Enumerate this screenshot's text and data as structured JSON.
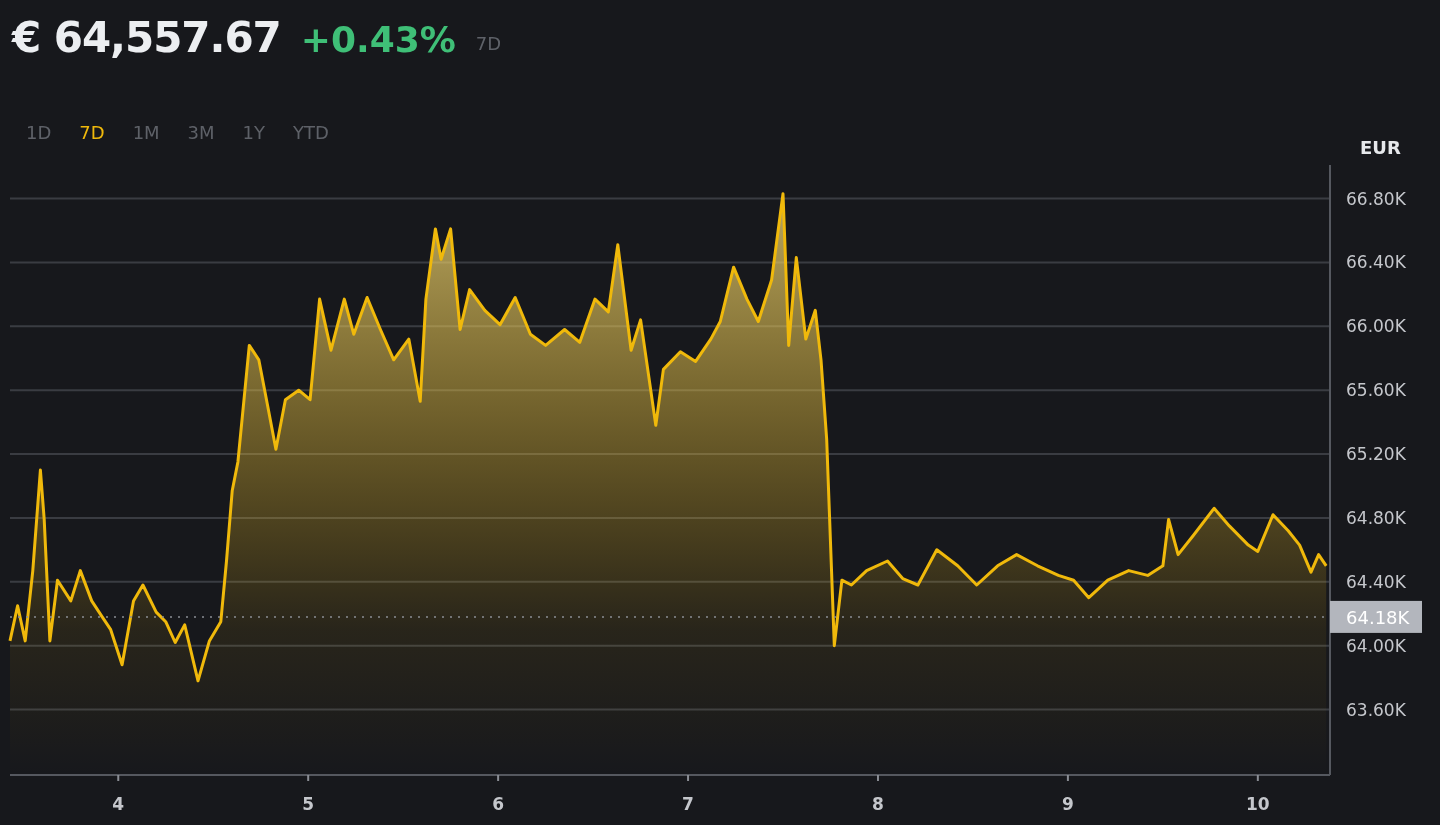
{
  "header": {
    "price": "€ 64,557.67",
    "change": "+0.43%",
    "period": "7D"
  },
  "range_tabs": [
    {
      "label": "1D",
      "selected": false
    },
    {
      "label": "7D",
      "selected": true
    },
    {
      "label": "1M",
      "selected": false
    },
    {
      "label": "3M",
      "selected": false
    },
    {
      "label": "1Y",
      "selected": false
    },
    {
      "label": "YTD",
      "selected": false
    }
  ],
  "chart": {
    "chart_data": {
      "type": "area",
      "grid": true,
      "ylabel": "EUR",
      "xlim": [
        3.43,
        10.38
      ],
      "ylim": [
        63.19,
        67.01
      ],
      "xticks": [
        4,
        5,
        6,
        7,
        8,
        9,
        10
      ],
      "yticks": [
        {
          "value": 66.8,
          "label": "66.80K"
        },
        {
          "value": 66.4,
          "label": "66.40K"
        },
        {
          "value": 66.0,
          "label": "66.00K"
        },
        {
          "value": 65.6,
          "label": "65.60K"
        },
        {
          "value": 65.2,
          "label": "65.20K"
        },
        {
          "value": 64.8,
          "label": "64.80K"
        },
        {
          "value": 64.4,
          "label": "64.40K"
        },
        {
          "value": 64.0,
          "label": "64.00K"
        },
        {
          "value": 63.6,
          "label": "63.60K"
        }
      ],
      "x": [
        3.43,
        3.47,
        3.51,
        3.55,
        3.59,
        3.61,
        3.64,
        3.68,
        3.75,
        3.8,
        3.86,
        3.91,
        3.96,
        4.02,
        4.08,
        4.13,
        4.2,
        4.25,
        4.3,
        4.35,
        4.42,
        4.48,
        4.54,
        4.57,
        4.6,
        4.63,
        4.69,
        4.74,
        4.79,
        4.83,
        4.88,
        4.95,
        5.01,
        5.06,
        5.12,
        5.19,
        5.24,
        5.31,
        5.38,
        5.45,
        5.53,
        5.59,
        5.62,
        5.67,
        5.7,
        5.75,
        5.8,
        5.85,
        5.93,
        6.01,
        6.09,
        6.17,
        6.25,
        6.35,
        6.43,
        6.51,
        6.58,
        6.63,
        6.7,
        6.75,
        6.83,
        6.87,
        6.96,
        7.04,
        7.12,
        7.17,
        7.24,
        7.31,
        7.37,
        7.44,
        7.5,
        7.53,
        7.57,
        7.62,
        7.67,
        7.7,
        7.73,
        7.77,
        7.81,
        7.86,
        7.94,
        8.05,
        8.13,
        8.21,
        8.31,
        8.42,
        8.52,
        8.63,
        8.73,
        8.84,
        8.95,
        9.03,
        9.11,
        9.21,
        9.32,
        9.42,
        9.5,
        9.53,
        9.58,
        9.66,
        9.77,
        9.85,
        9.95,
        10.0,
        10.08,
        10.16,
        10.22,
        10.28,
        10.32,
        10.36
      ],
      "series": [
        {
          "color": "#f0b90b",
          "values": [
            64.03,
            64.25,
            64.03,
            64.47,
            65.1,
            64.79,
            64.03,
            64.41,
            64.28,
            64.47,
            64.28,
            64.19,
            64.1,
            63.88,
            64.28,
            64.38,
            64.21,
            64.15,
            64.02,
            64.13,
            63.78,
            64.03,
            64.15,
            64.53,
            64.97,
            65.15,
            65.88,
            65.79,
            65.48,
            65.23,
            65.54,
            65.6,
            65.54,
            66.17,
            65.85,
            66.17,
            65.95,
            66.18,
            65.98,
            65.79,
            65.92,
            65.53,
            66.17,
            66.61,
            66.42,
            66.61,
            65.98,
            66.23,
            66.1,
            66.01,
            66.18,
            65.95,
            65.88,
            65.98,
            65.9,
            66.17,
            66.09,
            66.51,
            65.85,
            66.04,
            65.38,
            65.73,
            65.84,
            65.78,
            65.92,
            66.03,
            66.37,
            66.17,
            66.03,
            66.29,
            66.83,
            65.88,
            66.43,
            65.92,
            66.1,
            65.79,
            65.29,
            64.0,
            64.41,
            64.38,
            64.47,
            64.53,
            64.42,
            64.38,
            64.6,
            64.5,
            64.38,
            64.5,
            64.57,
            64.5,
            64.44,
            64.41,
            64.3,
            64.41,
            64.47,
            64.44,
            64.5,
            64.79,
            64.57,
            64.69,
            64.86,
            64.75,
            64.63,
            64.59,
            64.82,
            64.72,
            64.63,
            64.46,
            64.57,
            64.5
          ]
        }
      ],
      "ref_lines": [
        {
          "axis": "y",
          "value": 64.18,
          "label": "64.18K"
        }
      ]
    }
  }
}
